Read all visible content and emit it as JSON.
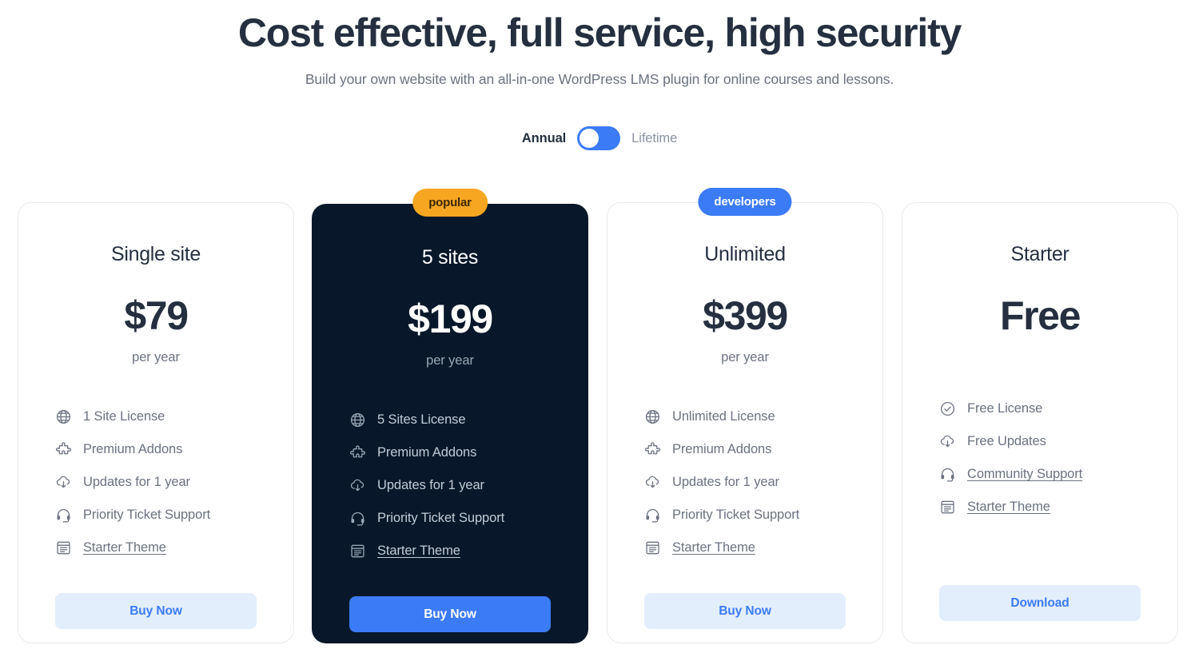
{
  "header": {
    "title": "Cost effective, full service, high security",
    "subtitle": "Build your own website with an all-in-one WordPress LMS plugin for online courses and lessons."
  },
  "billing_toggle": {
    "left_label": "Annual",
    "right_label": "Lifetime",
    "selected": "Annual",
    "track_color": "#3b7bf6",
    "knob_position": "left"
  },
  "colors": {
    "page_background": "#ffffff",
    "heading": "#252f40",
    "muted_text": "#6b7280",
    "accent_blue": "#3b7bf6",
    "soft_blue": "#e3eefd",
    "badge_orange": "#f7a622",
    "dark_card": "#08182a",
    "card_border": "#e8eaee"
  },
  "plans": [
    {
      "name": "Single site",
      "price": "$79",
      "period": "per year",
      "badge": null,
      "highlighted": false,
      "features": [
        {
          "icon": "globe-icon",
          "label": "1 Site License",
          "link": false
        },
        {
          "icon": "puzzle-icon",
          "label": "Premium Addons",
          "link": false
        },
        {
          "icon": "cloud-download-icon",
          "label": "Updates for 1 year",
          "link": false
        },
        {
          "icon": "headset-icon",
          "label": "Priority Ticket Support",
          "link": false
        },
        {
          "icon": "theme-icon",
          "label": "Starter Theme",
          "link": true
        }
      ],
      "cta": "Buy Now"
    },
    {
      "name": "5 sites",
      "price": "$199",
      "period": "per year",
      "badge": "popular",
      "highlighted": true,
      "features": [
        {
          "icon": "globe-icon",
          "label": "5 Sites License",
          "link": false
        },
        {
          "icon": "puzzle-icon",
          "label": "Premium Addons",
          "link": false
        },
        {
          "icon": "cloud-download-icon",
          "label": "Updates for 1 year",
          "link": false
        },
        {
          "icon": "headset-icon",
          "label": "Priority Ticket Support",
          "link": false
        },
        {
          "icon": "theme-icon",
          "label": "Starter Theme",
          "link": true
        }
      ],
      "cta": "Buy Now"
    },
    {
      "name": "Unlimited",
      "price": "$399",
      "period": "per year",
      "badge": "developers",
      "highlighted": false,
      "features": [
        {
          "icon": "globe-icon",
          "label": "Unlimited License",
          "link": false
        },
        {
          "icon": "puzzle-icon",
          "label": "Premium Addons",
          "link": false
        },
        {
          "icon": "cloud-download-icon",
          "label": "Updates for 1 year",
          "link": false
        },
        {
          "icon": "headset-icon",
          "label": "Priority Ticket Support",
          "link": false
        },
        {
          "icon": "theme-icon",
          "label": "Starter Theme",
          "link": true
        }
      ],
      "cta": "Buy Now"
    },
    {
      "name": "Starter",
      "price": "Free",
      "period": null,
      "badge": null,
      "highlighted": false,
      "features": [
        {
          "icon": "check-circle-icon",
          "label": "Free License",
          "link": false
        },
        {
          "icon": "cloud-download-icon",
          "label": "Free Updates",
          "link": false
        },
        {
          "icon": "headset-icon",
          "label": "Community Support",
          "link": true
        },
        {
          "icon": "theme-icon",
          "label": "Starter Theme",
          "link": true
        }
      ],
      "cta": "Download"
    }
  ]
}
